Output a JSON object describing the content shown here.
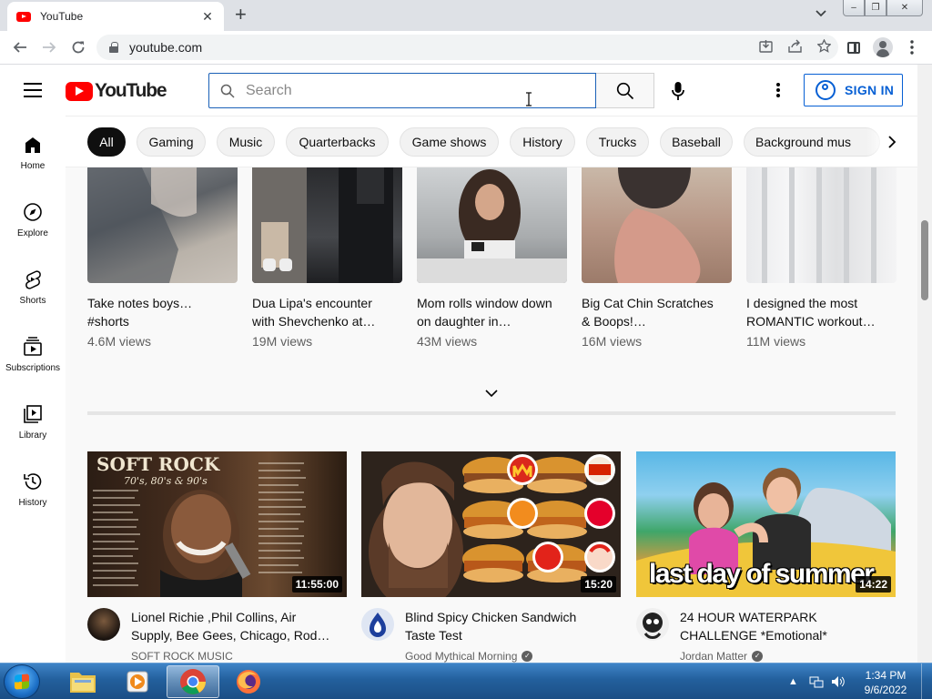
{
  "browser": {
    "tab_title": "YouTube",
    "tab_close": "✕",
    "new_tab": "+",
    "url": "youtube.com",
    "window_buttons": [
      "–",
      "❐",
      "✕"
    ]
  },
  "masthead": {
    "logo_text": "YouTube",
    "search_placeholder": "Search",
    "signin_label": "SIGN IN"
  },
  "chips": [
    "All",
    "Gaming",
    "Music",
    "Quarterbacks",
    "Game shows",
    "History",
    "Trucks",
    "Baseball",
    "Background mus"
  ],
  "guide": [
    {
      "label": "Home",
      "icon": "home-icon"
    },
    {
      "label": "Explore",
      "icon": "compass-icon"
    },
    {
      "label": "Shorts",
      "icon": "shorts-icon"
    },
    {
      "label": "Subscriptions",
      "icon": "subscriptions-icon"
    },
    {
      "label": "Library",
      "icon": "library-icon"
    },
    {
      "label": "History",
      "icon": "history-icon"
    }
  ],
  "shorts": [
    {
      "title": "Take notes boys… #shorts",
      "views": "4.6M views"
    },
    {
      "title": "Dua Lipa's encounter with Shevchenko at…",
      "views": "19M views"
    },
    {
      "title": "Mom rolls window down on daughter in…",
      "views": "43M views"
    },
    {
      "title": "Big Cat Chin Scratches & Boops!…",
      "views": "16M views"
    },
    {
      "title": "I designed the most ROMANTIC workout…",
      "views": "11M views"
    }
  ],
  "videos": [
    {
      "title": "Lionel Richie ,Phil Collins, Air Supply, Bee Gees, Chicago, Rod…",
      "channel": "SOFT ROCK MUSIC",
      "verified": false,
      "duration": "11:55:00",
      "thumb_text": "SOFT ROCK",
      "thumb_subtext": "70's, 80's & 90's"
    },
    {
      "title": "Blind Spicy Chicken Sandwich Taste Test",
      "channel": "Good Mythical Morning",
      "verified": true,
      "duration": "15:20"
    },
    {
      "title": "24 HOUR WATERPARK CHALLENGE *Emotional*",
      "channel": "Jordan Matter",
      "verified": true,
      "duration": "14:22",
      "thumb_text": "last day of summer"
    }
  ],
  "taskbar": {
    "time": "1:34 PM",
    "date": "9/6/2022"
  },
  "colors": {
    "yt_red": "#ff0000",
    "signin_blue": "#065fd4",
    "chip_active": "#0f0f0f"
  }
}
